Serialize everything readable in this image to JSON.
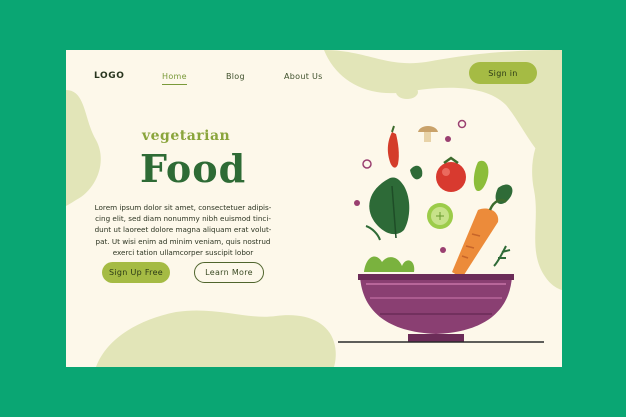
{
  "header": {
    "logo": "LOGO",
    "nav": [
      {
        "label": "Home",
        "active": true
      },
      {
        "label": "Blog",
        "active": false
      },
      {
        "label": "About Us",
        "active": false
      }
    ],
    "signin_label": "Sign in"
  },
  "hero": {
    "subtitle": "vegetarian",
    "title": "Food",
    "paragraph_lines": [
      "Lorem ipsum dolor sit amet, consectetuer adipis-",
      "cing elit, sed diam nonummy nibh euismod tinci-",
      "dunt ut laoreet dolore magna aliquam erat volut-",
      "pat. Ut wisi enim ad minim veniam, quis nostrud",
      "exerci tation ullamcorper suscipit lobor"
    ],
    "signup_label": "Sign Up Free",
    "learn_label": "Learn More"
  },
  "colors": {
    "background": "#0aa673",
    "page": "#fdf8ea",
    "accent_green": "#a5bb44",
    "title_green": "#2e6b35",
    "blob": "#dfe2b4",
    "bowl": "#8a3f72"
  },
  "icons": [
    "salad-bowl-icon",
    "carrot-icon",
    "chili-pepper-icon",
    "tomato-icon",
    "mushroom-icon",
    "lettuce-leaf-icon",
    "cucumber-slice-icon"
  ]
}
